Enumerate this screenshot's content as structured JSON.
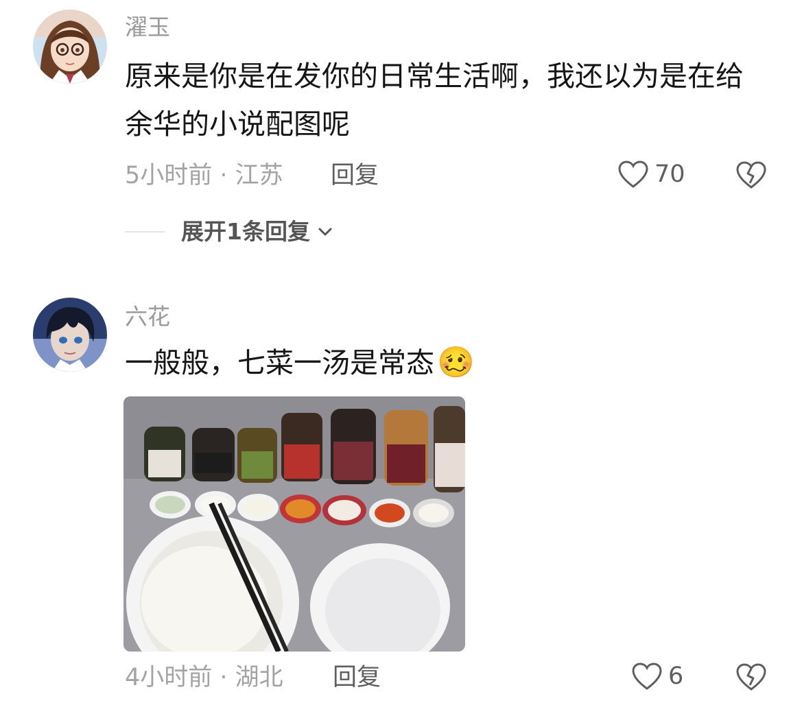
{
  "comments": [
    {
      "username": "濯玉",
      "text": "原来是你是在发你的日常生活啊，我还以为是在给余华的小说配图呢",
      "time_location": "5小时前 · 江苏",
      "reply_label": "回复",
      "likes": "70",
      "expand_label": "展开1条回复"
    },
    {
      "username": "六花",
      "text": "一般般，七菜一汤是常态",
      "emoji": "🥴",
      "time_location": "4小时前 · 湖北",
      "reply_label": "回复",
      "likes": "6"
    }
  ],
  "icons": {
    "like": "heart-outline-icon",
    "dislike": "broken-heart-icon",
    "expand": "chevron-down-icon"
  },
  "colors": {
    "meta": "#a3a3a3",
    "username": "#9a9a9a",
    "text": "#161616"
  }
}
